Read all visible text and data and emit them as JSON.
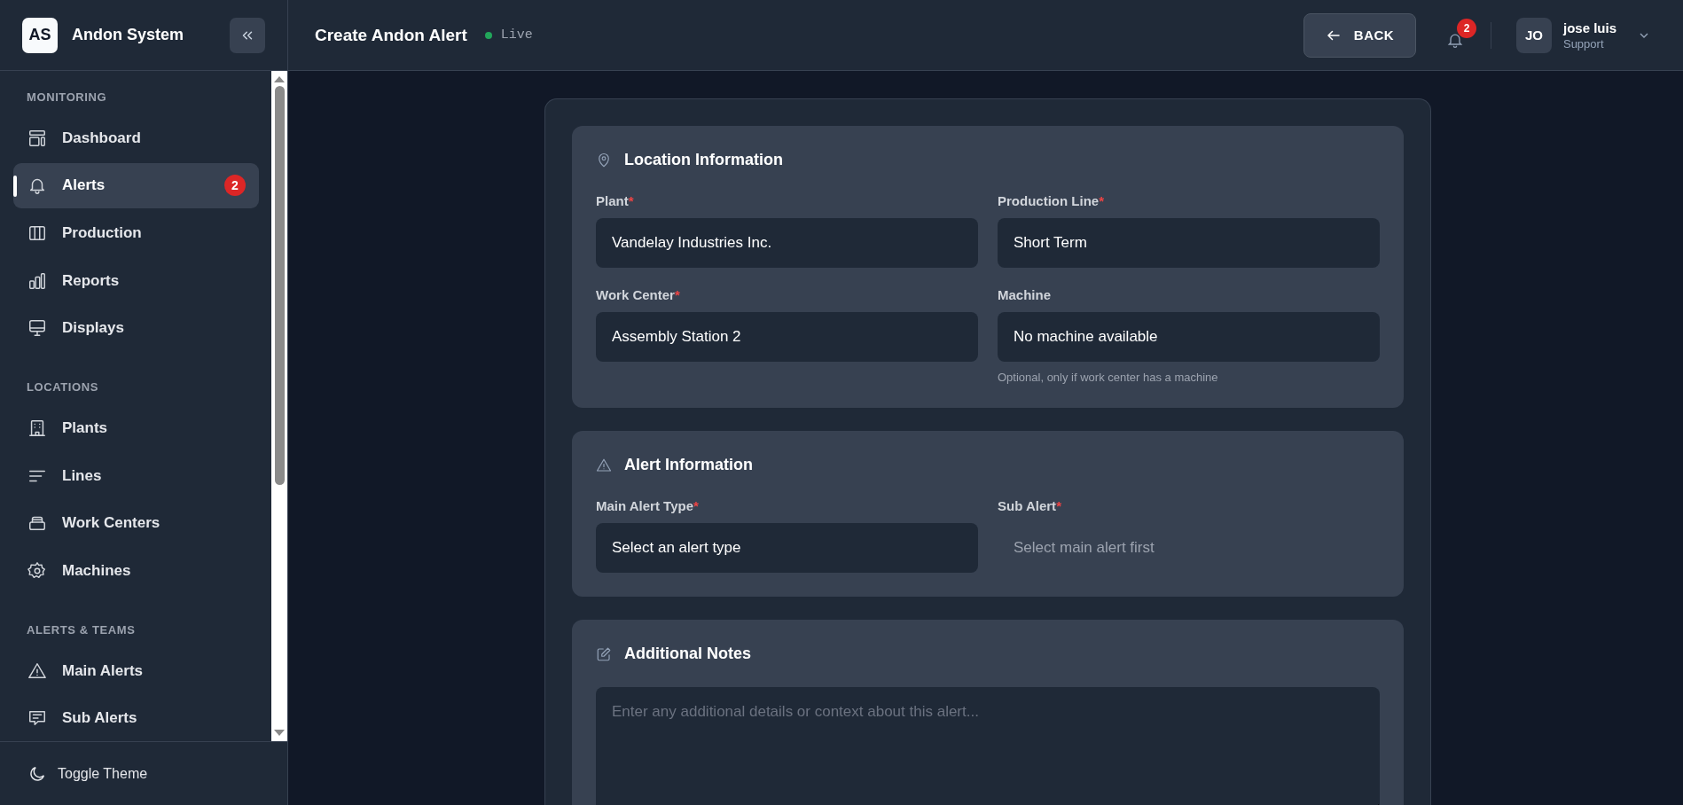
{
  "sidebar": {
    "logo": "AS",
    "app_name": "Andon System",
    "sections": [
      {
        "title": "MONITORING",
        "items": [
          {
            "label": "Dashboard",
            "selected": false
          },
          {
            "label": "Alerts",
            "selected": true,
            "badge": "2"
          },
          {
            "label": "Production",
            "selected": false
          },
          {
            "label": "Reports",
            "selected": false
          },
          {
            "label": "Displays",
            "selected": false
          }
        ]
      },
      {
        "title": "LOCATIONS",
        "items": [
          {
            "label": "Plants",
            "selected": false
          },
          {
            "label": "Lines",
            "selected": false
          },
          {
            "label": "Work Centers",
            "selected": false
          },
          {
            "label": "Machines",
            "selected": false
          }
        ]
      },
      {
        "title": "ALERTS & TEAMS",
        "items": [
          {
            "label": "Main Alerts",
            "selected": false
          },
          {
            "label": "Sub Alerts",
            "selected": false
          }
        ]
      }
    ],
    "footer": "Toggle Theme"
  },
  "header": {
    "title": "Create Andon Alert",
    "status": "Live",
    "back": "BACK",
    "notification_count": "2",
    "user": {
      "initials": "JO",
      "name": "jose luis",
      "role": "Support"
    }
  },
  "form": {
    "sections": [
      {
        "title": "Location Information",
        "fields": [
          {
            "label": "Plant",
            "required_mark": "*",
            "value": "Vandelay Industries Inc.",
            "disabled": false
          },
          {
            "label": "Production Line",
            "required_mark": "*",
            "value": "Short Term",
            "disabled": false
          },
          {
            "label": "Work Center",
            "required_mark": "*",
            "value": "Assembly Station 2",
            "disabled": false
          },
          {
            "label": "Machine",
            "value": "No machine available",
            "disabled": false,
            "hint": "Optional, only if work center has a machine"
          }
        ]
      },
      {
        "title": "Alert Information",
        "fields": [
          {
            "label": "Main Alert Type",
            "required_mark": "*",
            "value": "Select an alert type",
            "disabled": false
          },
          {
            "label": "Sub Alert",
            "required_mark": "*",
            "placeholder": "Select main alert first",
            "disabled": true
          }
        ]
      },
      {
        "title": "Additional Notes",
        "notes_placeholder": "Enter any additional details or context about this alert..."
      }
    ]
  }
}
